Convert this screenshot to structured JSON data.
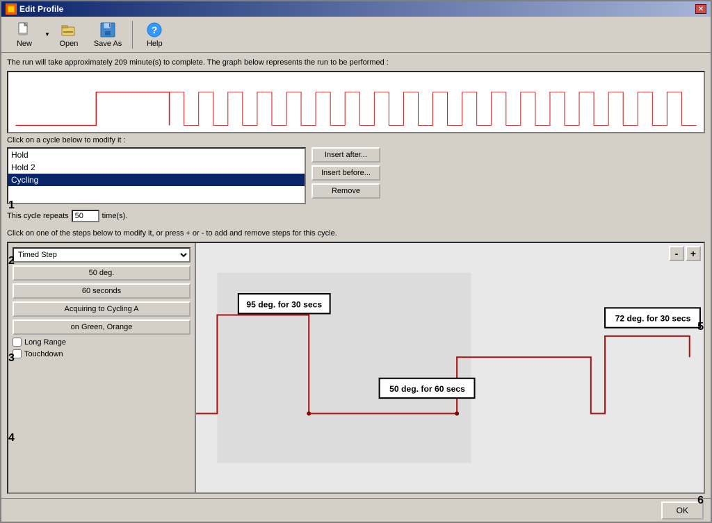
{
  "window": {
    "title": "Edit Profile",
    "close_icon": "✕"
  },
  "toolbar": {
    "new_label": "New",
    "open_label": "Open",
    "save_as_label": "Save As",
    "help_label": "Help"
  },
  "info": {
    "run_time_text": "The run will take approximately 209 minute(s) to complete. The graph below represents the run to be performed :"
  },
  "cycle_section": {
    "label": "Click on a cycle below to modify it :",
    "items": [
      {
        "label": "Hold",
        "selected": false
      },
      {
        "label": "Hold 2",
        "selected": false
      },
      {
        "label": "Cycling",
        "selected": true
      }
    ],
    "insert_after_label": "Insert after...",
    "insert_before_label": "Insert before...",
    "remove_label": "Remove"
  },
  "repeat_row": {
    "prefix": "This cycle repeats",
    "value": "50",
    "suffix": "time(s)."
  },
  "step_instruction": "Click on one of the steps below to modify it, or press + or - to add and remove steps for this cycle.",
  "step_controls": {
    "type_label": "Timed Step",
    "degree_label": "50 deg.",
    "seconds_label": "60 seconds",
    "acquiring_label": "Acquiring to Cycling A",
    "on_label": "on Green, Orange",
    "long_range_label": "Long Range",
    "touchdown_label": "Touchdown",
    "minus_label": "-",
    "plus_label": "+"
  },
  "annotations": {
    "box1": "95 deg. for 30 secs",
    "box2": "50 deg. for 60 secs",
    "box3": "72 deg. for 30 secs"
  },
  "number_labels": {
    "n1": "1",
    "n2": "2",
    "n3": "3",
    "n4": "4",
    "n5": "5",
    "n6": "6"
  },
  "ok_label": "OK"
}
